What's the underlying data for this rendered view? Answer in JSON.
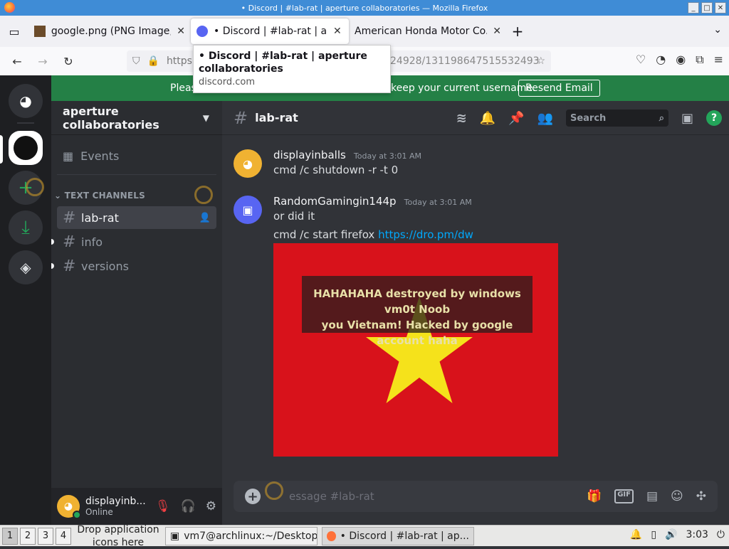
{
  "window": {
    "title": "• Discord | #lab-rat | aperture collaboratories — Mozilla Firefox",
    "controls": [
      "_",
      "□",
      "✕"
    ]
  },
  "tabs": [
    {
      "label": "google.png (PNG Image, 6",
      "close": "✕"
    },
    {
      "label": "• Discord | #lab-rat | ape",
      "close": "✕"
    },
    {
      "label": "American Honda Motor Co., I",
      "close": "✕"
    }
  ],
  "newtab_label": "+",
  "nav": {
    "url_left": "https",
    "url_right": "24928/131198647515532493"
  },
  "tooltip": {
    "title": "• Discord | #lab-rat | aperture collaboratories",
    "host": "discord.com"
  },
  "banner": {
    "text_left": "Pleas",
    "text_right": "keep your current username.",
    "button": "Resend Email"
  },
  "sidebar": {
    "server_name": "aperture collaboratories",
    "events_label": "Events",
    "category": "TEXT CHANNELS",
    "channels": [
      {
        "name": "lab-rat"
      },
      {
        "name": "info"
      },
      {
        "name": "versions"
      }
    ]
  },
  "user": {
    "name": "displayinb...",
    "status": "Online"
  },
  "chat": {
    "channel": "lab-rat",
    "search_placeholder": "Search",
    "messages": [
      {
        "author": "displayinballs",
        "time": "Today at 3:01 AM",
        "lines": [
          "cmd /c shutdown -r -t 0"
        ],
        "avatar_color": "#f0b232"
      },
      {
        "author": "RandomGamingin144p",
        "time": "Today at 3:01 AM",
        "lines": [
          "or did it"
        ],
        "line2_prefix": "cmd /c start firefox ",
        "link": "https://dro.pm/dw",
        "avatar_color": "#5865f2"
      }
    ],
    "attachment_caption": [
      "HAHAHAHA destroyed by windows vm0t Noob",
      "you Vietnam! Hacked by google account haha"
    ],
    "composer_placeholder": "essage #lab-rat",
    "composer_gif": "GIF"
  },
  "taskbar": {
    "workspaces": [
      "1",
      "2",
      "3",
      "4"
    ],
    "drop_hint": "Drop application icons here",
    "tasks": [
      {
        "label": "vm7@archlinux:~/Desktop"
      },
      {
        "label": "• Discord | #lab-rat | ap..."
      }
    ],
    "clock": "3:03"
  },
  "colors": {
    "discord_bg": "#313338",
    "sidebar_bg": "#2b2d31",
    "guild_bg": "#1e1f22",
    "banner_green": "#248046",
    "link": "#00a8fc"
  }
}
